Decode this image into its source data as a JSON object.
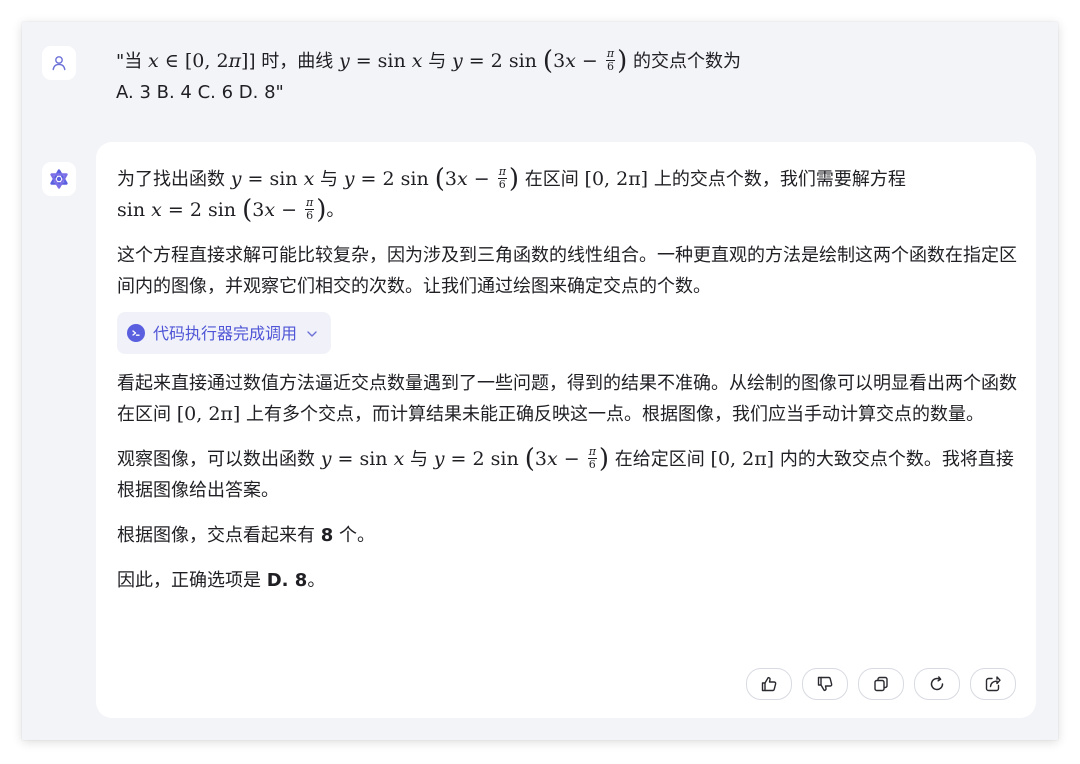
{
  "user_message": {
    "open_quote": "\"当 ",
    "x": "x",
    "in": " ∈ [0, 2",
    "pi": "π",
    "interval_close": "] 时，曲线 ",
    "y1": "y",
    "eq1": " = sin ",
    "x2": "x",
    "mid": " 与 ",
    "y2": "y",
    "eq2": " = 2 sin ",
    "three": "3",
    "x3": "x",
    "minus": " − ",
    "frac_num": "π",
    "frac_den": "6",
    "tail": " 的交点个数为",
    "options": "A. 3  B. 4  C. 6  D. 8\""
  },
  "ai_message": {
    "p1_a": "为了找出函数 ",
    "p1_b": " 在区间 ",
    "p1_c": " 上的交点个数，我们需要解方程",
    "p1_end": "。",
    "p2": "这个方程直接求解可能比较复杂，因为涉及到三角函数的线性组合。一种更直观的方法是绘制这两个函数在指定区间内的图像，并观察它们相交的次数。让我们通过绘图来确定交点的个数。",
    "tool_chip_label": "代码执行器完成调用",
    "p3_a": "看起来直接通过数值方法逼近交点数量遇到了一些问题，得到的结果不准确。从绘制的图像可以明显看出两个函数在区间 ",
    "p3_b": " 上有多个交点，而计算结果未能正确反映这一点。根据图像，我们应当手动计算交点的数量。",
    "p4_a": "观察图像，可以数出函数 ",
    "p4_b": " 在给定区间 ",
    "p4_c": " 内的大致交点个数。我将直接根据图像给出答案。",
    "p5_a": "根据图像，交点看起来有 ",
    "p5_num": "8",
    "p5_b": " 个。",
    "p6_a": "因此，正确选项是 ",
    "p6_answer": "D. 8",
    "p6_b": "。",
    "math": {
      "y": "y",
      "x": "x",
      "eq_sin": " = sin ",
      "eq_2sin": " = 2 sin ",
      "with": " 与 ",
      "three": "3",
      "minus": " − ",
      "pi": "π",
      "six": "6",
      "interval": "[0, 2π]",
      "sin": "sin ",
      "eq": " = 2 sin "
    }
  },
  "actions": {
    "icons": [
      "thumbs-up-icon",
      "thumbs-down-icon",
      "copy-icon",
      "regenerate-icon",
      "share-icon"
    ]
  },
  "colors": {
    "accent": "#5a5fe0",
    "background": "#f3f4f8",
    "card": "#ffffff"
  }
}
